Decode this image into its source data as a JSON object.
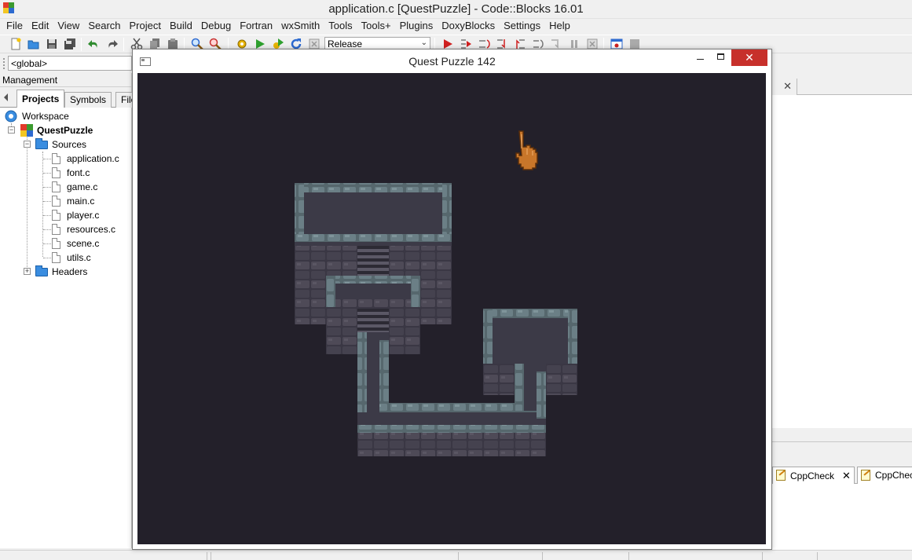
{
  "ide": {
    "window_title": "application.c [QuestPuzzle] - Code::Blocks 16.01",
    "menu": [
      "File",
      "Edit",
      "View",
      "Search",
      "Project",
      "Build",
      "Debug",
      "Fortran",
      "wxSmith",
      "Tools",
      "Tools+",
      "Plugins",
      "DoxyBlocks",
      "Settings",
      "Help"
    ],
    "build_target": "Release",
    "scope": "<global>",
    "management": {
      "title": "Management",
      "tabs": [
        "Projects",
        "Symbols",
        "File"
      ],
      "tree": {
        "workspace": "Workspace",
        "project": "QuestPuzzle",
        "sources_label": "Sources",
        "sources": [
          "application.c",
          "font.c",
          "game.c",
          "main.c",
          "player.c",
          "resources.c",
          "scene.c",
          "utils.c"
        ],
        "headers_label": "Headers"
      }
    },
    "logs_tabs": [
      "CppCheck",
      "CppCheck"
    ]
  },
  "game_window": {
    "title": "Quest Puzzle 142"
  },
  "colors": {
    "canvas_bg": "#23202a",
    "floor": "#3c3a47",
    "wall_cap": "#6b7f86",
    "wall_face": "#4e4a57",
    "close_button": "#c7302b"
  }
}
